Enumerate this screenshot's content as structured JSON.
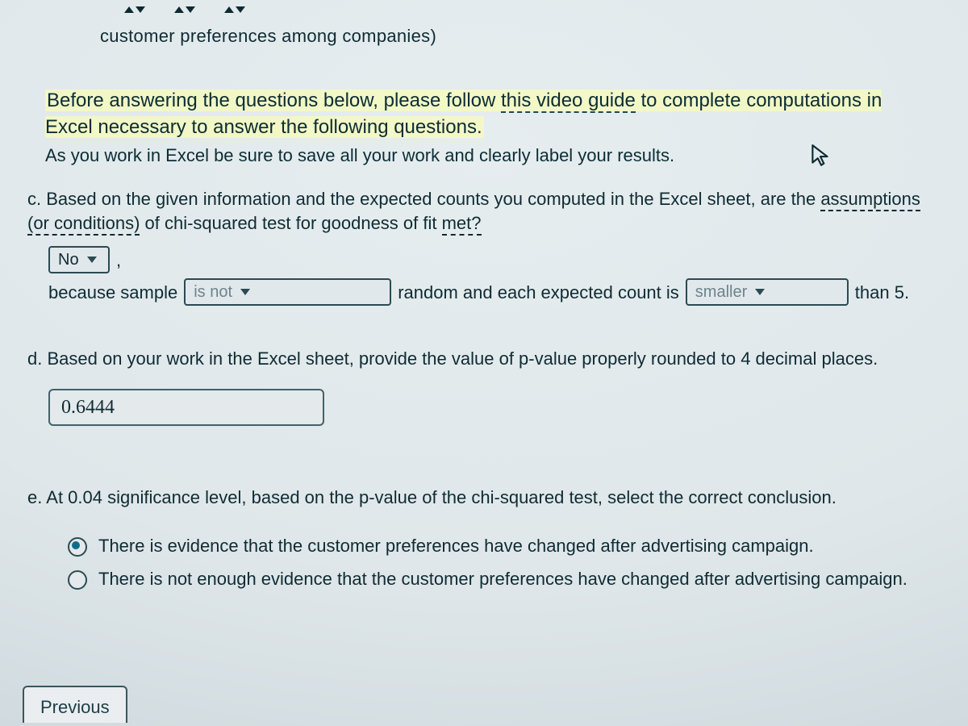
{
  "header_fragment": "customer preferences among companies)",
  "instructions": {
    "highlighted_1": "Before answering the questions below, please follow ",
    "link_text": "this video guide",
    "highlighted_2": " to complete computations in Excel necessary to answer the following questions.",
    "subline": "As you work in Excel be sure to save all your work and clearly label your results."
  },
  "question_c": {
    "label": "c.",
    "text_pre": "Based on the given information and the expected counts you computed in the Excel sheet, are the ",
    "dashed_span": "assumptions (or conditions)",
    "text_mid": " of chi-squared test for goodness of fit ",
    "dashed_span2": "met?",
    "select1_value": "No",
    "after_select1": ",",
    "line2_pre": "because sample ",
    "select2_placeholder": "is not",
    "line2_mid": " random and each expected count is ",
    "select3_placeholder": "smaller",
    "line2_end": " than 5."
  },
  "question_d": {
    "label": "d.",
    "text": "Based on your work in the Excel sheet, provide the value of p-value properly rounded to 4 decimal places.",
    "input_value": "0.6444"
  },
  "question_e": {
    "label": "e.",
    "text": "At 0.04 significance level, based on the p-value of the chi-squared test, select the correct conclusion.",
    "options": [
      "There is evidence that the customer preferences have changed after advertising campaign.",
      "There is not enough evidence that the customer preferences have changed after advertising campaign."
    ],
    "selected": 0
  },
  "nav": {
    "previous": "Previous"
  }
}
